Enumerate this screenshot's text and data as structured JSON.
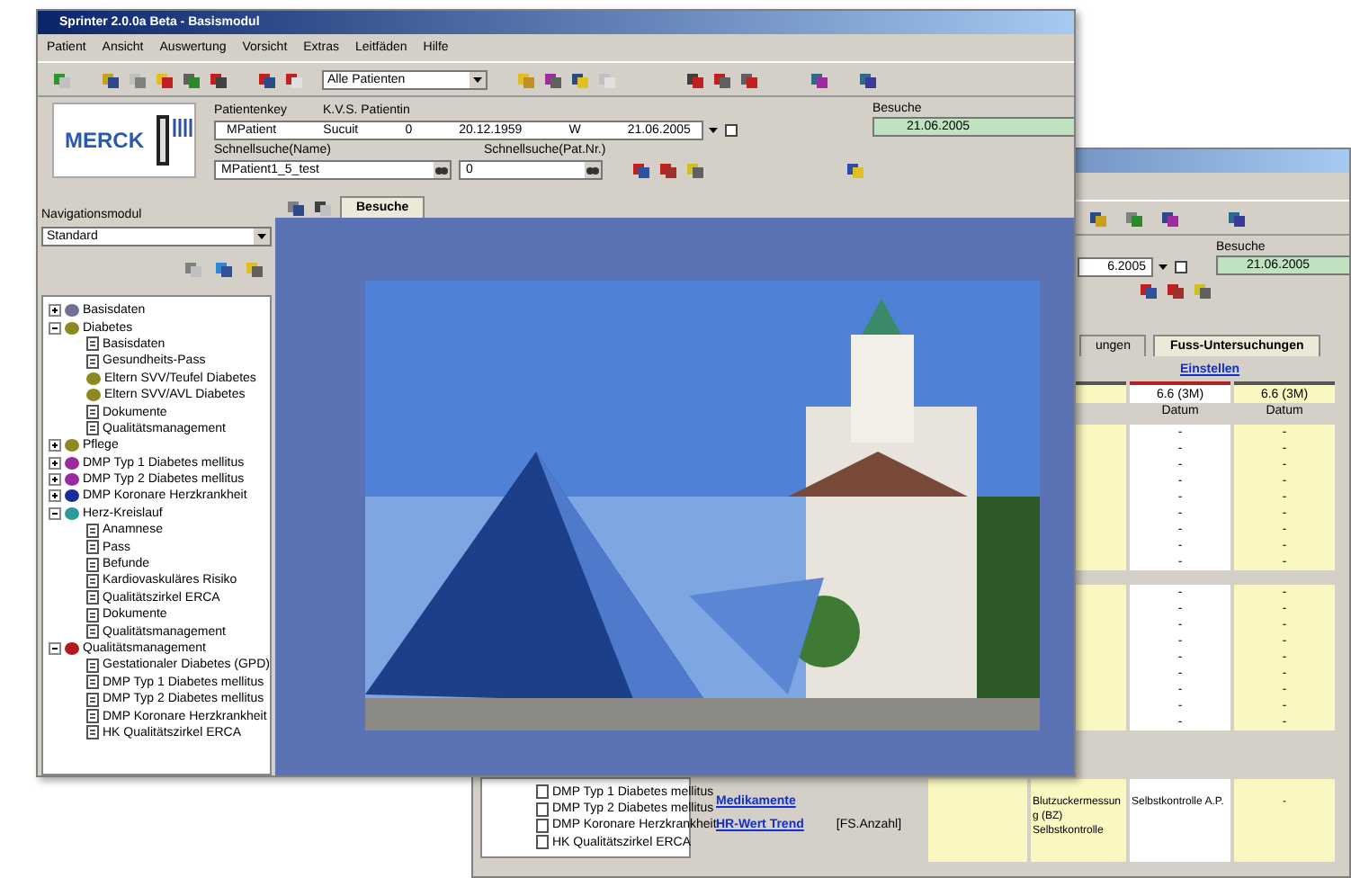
{
  "back_window": {
    "date_field": "6.2005",
    "visits": {
      "label": "Besuche",
      "value": "21.06.2005"
    },
    "tabs": [
      {
        "label": "ungen",
        "selected": false
      },
      {
        "label": "Fuss-Untersuchungen",
        "selected": true
      }
    ],
    "link": "Einstellen",
    "column_headers": [
      "6.6 (3M)",
      "6.6 (3M)"
    ],
    "column_subheaders": [
      "Datum",
      "Datum"
    ],
    "row_groups": [
      {
        "rows": [
          [
            "-",
            "-"
          ],
          [
            "-",
            "-"
          ],
          [
            "-",
            "-"
          ],
          [
            "-",
            "-"
          ],
          [
            "-",
            "-"
          ],
          [
            "-",
            "-"
          ],
          [
            "-",
            "-"
          ],
          [
            "-",
            "-"
          ],
          [
            "-",
            "-"
          ]
        ]
      },
      {
        "rows": [
          [
            "-",
            "-"
          ],
          [
            "-",
            "-"
          ],
          [
            "-",
            "-"
          ],
          [
            "-",
            "-"
          ],
          [
            "-",
            "-"
          ],
          [
            "-",
            "-"
          ],
          [
            "-",
            "-"
          ],
          [
            "-",
            "-"
          ],
          [
            "-",
            "-"
          ]
        ]
      }
    ],
    "tree": [
      "DMP Typ 1 Diabetes mellitus",
      "DMP Typ 2 Diabetes mellitus",
      "DMP Koronare Herzkrankheit",
      "HK Qualitätszirkel ERCA"
    ],
    "links": [
      "Medikamente",
      "HR-Wert Trend"
    ],
    "note": "[FS.Anzahl]",
    "cells": [
      "Blutzuckermessung (BZ) Selbstkontrolle",
      "Selbstkontrolle A.P.",
      "-"
    ]
  },
  "front_window": {
    "title": "Sprinter 2.0.0a Beta - Basismodul",
    "menu": [
      "Patient",
      "Ansicht",
      "Auswertung",
      "Vorsicht",
      "Extras",
      "Leitfäden",
      "Hilfe"
    ],
    "patient_filter": "Alle Patienten",
    "logo": "MERCK",
    "patient": {
      "labels": [
        "Patientenkey",
        "K.V.S. Patientin"
      ],
      "values": [
        "MPatient",
        "Sucuit",
        "0",
        "20.12.1959",
        "W",
        "21.06.2005"
      ]
    },
    "visits": {
      "label": "Besuche",
      "value": "21.06.2005"
    },
    "quick_search_name": {
      "label": "Schnellsuche(Name)",
      "value": "MPatient1_5_test"
    },
    "quick_search_number": {
      "label": "Schnellsuche(Pat.Nr.)",
      "value": "0"
    },
    "navigation": {
      "label": "Navigationsmodul",
      "value": "Standard"
    },
    "tree": [
      {
        "label": "Basisdaten",
        "kind": "folder",
        "color": "#707090",
        "expanded": false
      },
      {
        "label": "Diabetes",
        "kind": "folder",
        "color": "#8a8a20",
        "expanded": true,
        "children": [
          {
            "label": "Basisdaten",
            "kind": "document"
          },
          {
            "label": "Gesundheits-Pass",
            "kind": "document"
          },
          {
            "label": "Eltern SVV/Teufel Diabetes",
            "kind": "folder",
            "color": "#8a8a20"
          },
          {
            "label": "Eltern SVV/AVL Diabetes",
            "kind": "folder",
            "color": "#8a8a20"
          },
          {
            "label": "Dokumente",
            "kind": "document"
          },
          {
            "label": "Qualitätsmanagement",
            "kind": "document"
          }
        ]
      },
      {
        "label": "Pflege",
        "kind": "folder",
        "color": "#8a8a20",
        "expanded": false
      },
      {
        "label": "DMP Typ 1 Diabetes mellitus",
        "kind": "folder",
        "color": "#9a2aa0",
        "expanded": false
      },
      {
        "label": "DMP Typ 2 Diabetes mellitus",
        "kind": "folder",
        "color": "#9a2aa0",
        "expanded": false
      },
      {
        "label": "DMP Koronare Herzkrankheit",
        "kind": "folder",
        "color": "#1a2a9a",
        "expanded": false
      },
      {
        "label": "Herz-Kreislauf",
        "kind": "folder",
        "color": "#2a9a9a",
        "expanded": true,
        "children": [
          {
            "label": "Anamnese",
            "kind": "document"
          },
          {
            "label": "Pass",
            "kind": "document"
          },
          {
            "label": "Befunde",
            "kind": "document"
          },
          {
            "label": "Kardiovaskuläres Risiko",
            "kind": "document"
          },
          {
            "label": "Qualitätszirkel ERCA",
            "kind": "document"
          },
          {
            "label": "Dokumente",
            "kind": "document"
          },
          {
            "label": "Qualitätsmanagement",
            "kind": "document"
          }
        ]
      },
      {
        "label": "Qualitätsmanagement",
        "kind": "folder",
        "color": "#b01a1a",
        "expanded": true,
        "children": [
          {
            "label": "Gestationaler Diabetes (GPD)",
            "kind": "document"
          },
          {
            "label": "DMP Typ 1 Diabetes mellitus",
            "kind": "document"
          },
          {
            "label": "DMP Typ 2 Diabetes mellitus",
            "kind": "document"
          },
          {
            "label": "DMP Koronare Herzkrankheit",
            "kind": "document"
          },
          {
            "label": "HK Qualitätszirkel ERCA",
            "kind": "document"
          }
        ]
      }
    ],
    "tab": "Besuche"
  }
}
